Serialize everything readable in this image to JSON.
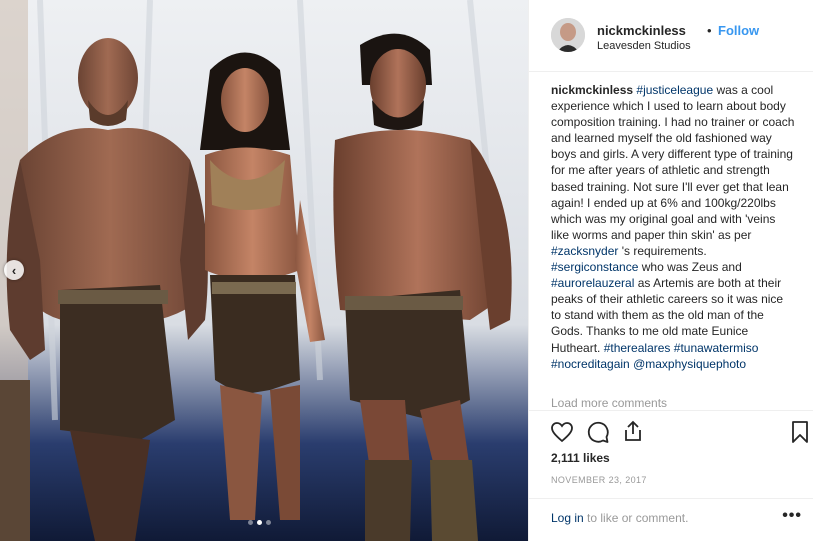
{
  "post": {
    "username": "nickmckinless",
    "separator": "•",
    "follow_label": "Follow",
    "location": "Leavesden Studios",
    "avatar_icon": "profile-photo",
    "caption_user": "nickmckinless",
    "caption_parts": [
      {
        "type": "tag",
        "text": "#justiceleague"
      },
      {
        "type": "text",
        "text": " was a cool experience which I used to learn about body composition training. I had no trainer or coach and learned myself the old fashioned way boys and girls. A very different type of training for me after years of athletic and strength based training. Not sure I'll ever get that lean again! I ended up at 6% and 100kg/220lbs which was my original goal and with 'veins like worms and paper thin skin' as per "
      },
      {
        "type": "tag",
        "text": "#zacksnyder"
      },
      {
        "type": "text",
        "text": " 's requirements. "
      },
      {
        "type": "tag",
        "text": "#sergiconstance"
      },
      {
        "type": "text",
        "text": " who was Zeus and "
      },
      {
        "type": "tag",
        "text": "#aurorelauzeral"
      },
      {
        "type": "text",
        "text": " as Artemis are both at their peaks of their athletic careers so it was nice to stand with them as the old man of the Gods. Thanks to me old mate Eunice Hutheart. "
      },
      {
        "type": "tag",
        "text": "#therealares"
      },
      {
        "type": "text",
        "text": " "
      },
      {
        "type": "tag",
        "text": "#tunawatermiso"
      },
      {
        "type": "text",
        "text": " "
      },
      {
        "type": "tag",
        "text": "#nocreditagain"
      },
      {
        "type": "text",
        "text": " "
      },
      {
        "type": "tag",
        "text": "@maxphysiquephoto"
      }
    ],
    "load_more": "Load more comments",
    "likes": "2,111 likes",
    "date": "NOVEMBER 23, 2017",
    "login_link": "Log in",
    "login_rest": " to like or comment.",
    "more_options": "•••"
  },
  "media": {
    "prev_arrow": "‹",
    "carousel": {
      "count": 3,
      "active": 2
    }
  },
  "colors": {
    "link": "#003569",
    "follow": "#3897f0",
    "muted": "#999999",
    "text": "#262626"
  },
  "icons": [
    "heart-icon",
    "comment-icon",
    "share-icon",
    "bookmark-icon",
    "chevron-left-icon",
    "more-options-icon"
  ]
}
